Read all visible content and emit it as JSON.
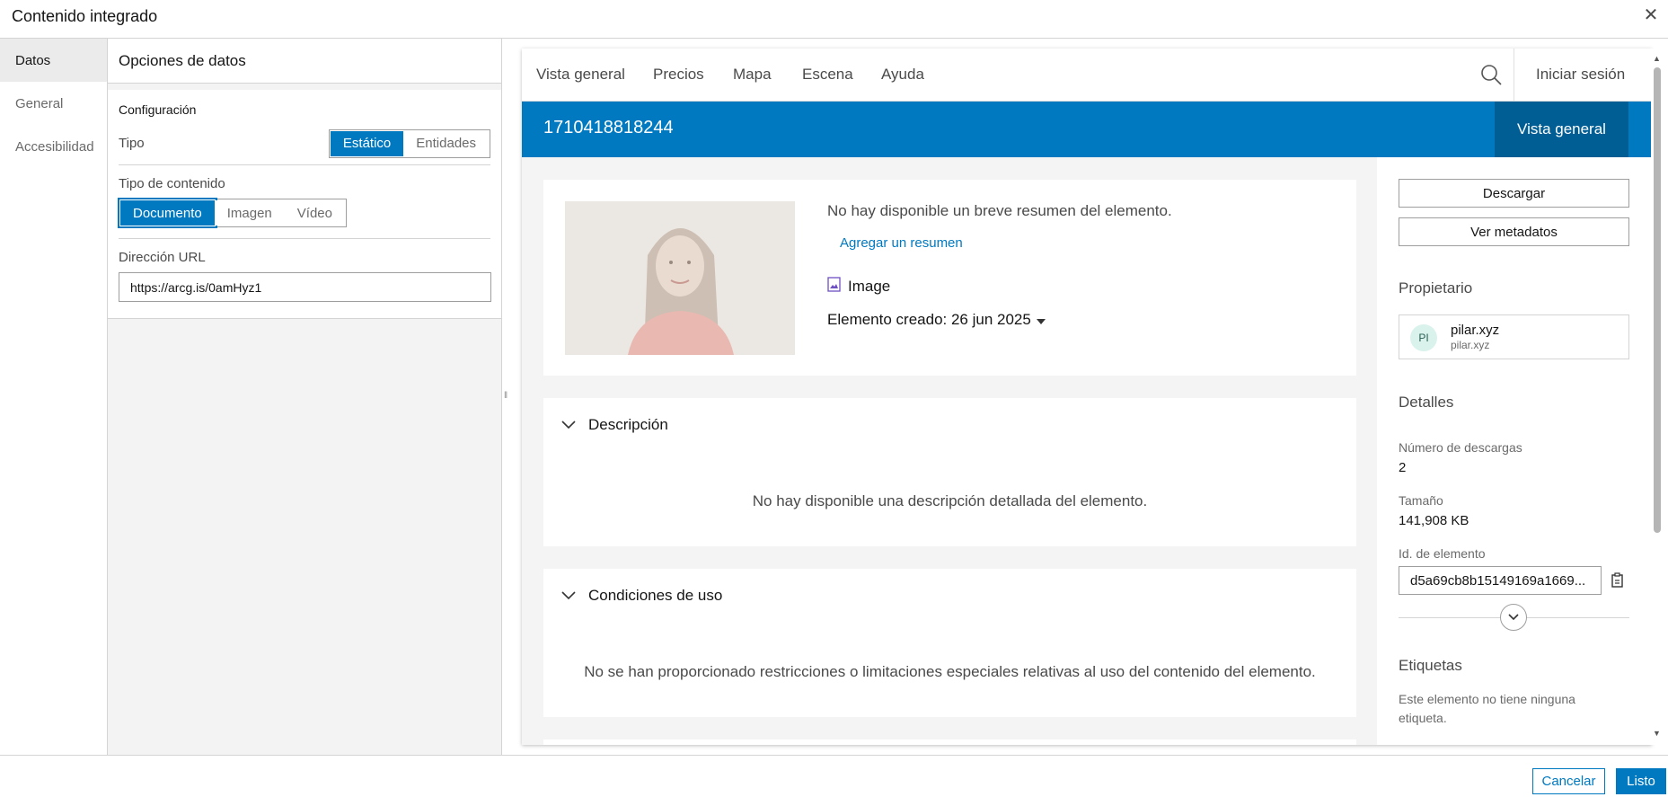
{
  "dialog": {
    "title": "Contenido integrado",
    "close_icon": "close-icon",
    "cancel_label": "Cancelar",
    "done_label": "Listo"
  },
  "left_nav": {
    "items": [
      {
        "label": "Datos",
        "active": true
      },
      {
        "label": "General",
        "active": false
      },
      {
        "label": "Accesibilidad",
        "active": false
      }
    ]
  },
  "options": {
    "heading": "Opciones de datos",
    "config_title": "Configuración",
    "tipo_label": "Tipo",
    "tipo_options": [
      "Estático",
      "Entidades"
    ],
    "tipo_selected": "Estático",
    "content_type_label": "Tipo de contenido",
    "content_type_options": [
      "Documento",
      "Imagen",
      "Vídeo"
    ],
    "content_type_selected": "Documento",
    "url_label": "Dirección URL",
    "url_value": "https://arcg.is/0amHyz1"
  },
  "preview": {
    "nav": [
      "Vista general",
      "Precios",
      "Mapa",
      "Escena",
      "Ayuda"
    ],
    "signin_label": "Iniciar sesión",
    "item_title": "1710418818244",
    "banner_tab": "Vista general",
    "summary_text": "No hay disponible un breve resumen del elemento.",
    "add_summary": "Agregar un resumen",
    "item_type": "Image",
    "created": "Elemento creado: 26 jun 2025",
    "description_title": "Descripción",
    "description_body": "No hay disponible una descripción detallada del elemento.",
    "terms_title": "Condiciones de uso",
    "terms_body": "No se han proporcionado restricciones o limitaciones especiales relativas al uso del contenido del elemento.",
    "download_label": "Descargar",
    "metadata_label": "Ver metadatos",
    "owner_heading": "Propietario",
    "owner_initials": "PI",
    "owner_name": "pilar.xyz",
    "owner_user": "pilar.xyz",
    "details_heading": "Detalles",
    "downloads_label": "Número de descargas",
    "downloads_value": "2",
    "size_label": "Tamaño",
    "size_value": "141,908 KB",
    "id_label": "Id. de elemento",
    "id_value": "d5a69cb8b15149169a1669...",
    "tags_heading": "Etiquetas",
    "tags_text": "Este elemento no tiene ninguna etiqueta."
  },
  "colors": {
    "accent": "#0079c1",
    "accent_dark": "#005e95"
  }
}
